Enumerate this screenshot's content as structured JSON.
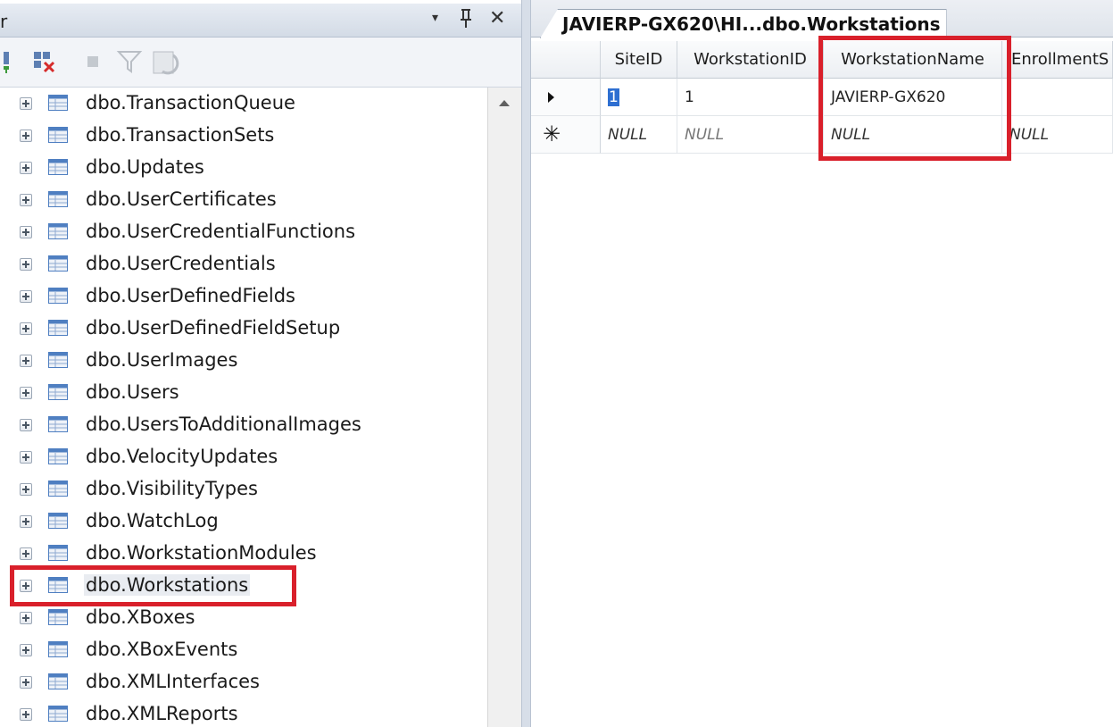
{
  "left_pane": {
    "title": "r",
    "dropdown_glyph": "▾",
    "pin_glyph": "ᚹ",
    "close_glyph": "✕",
    "toolbar": [
      "connect-icon",
      "disconnect-icon",
      "stop-icon",
      "filter-icon",
      "refresh-icon"
    ],
    "tree_items": [
      {
        "label": "dbo.TransactionQueue"
      },
      {
        "label": "dbo.TransactionSets"
      },
      {
        "label": "dbo.Updates"
      },
      {
        "label": "dbo.UserCertificates"
      },
      {
        "label": "dbo.UserCredentialFunctions"
      },
      {
        "label": "dbo.UserCredentials"
      },
      {
        "label": "dbo.UserDefinedFields"
      },
      {
        "label": "dbo.UserDefinedFieldSetup"
      },
      {
        "label": "dbo.UserImages"
      },
      {
        "label": "dbo.Users"
      },
      {
        "label": "dbo.UsersToAdditionalImages"
      },
      {
        "label": "dbo.VelocityUpdates"
      },
      {
        "label": "dbo.VisibilityTypes"
      },
      {
        "label": "dbo.WatchLog"
      },
      {
        "label": "dbo.WorkstationModules"
      },
      {
        "label": "dbo.Workstations",
        "selected": true
      },
      {
        "label": "dbo.XBoxes"
      },
      {
        "label": "dbo.XBoxEvents"
      },
      {
        "label": "dbo.XMLInterfaces"
      },
      {
        "label": "dbo.XMLReports"
      }
    ]
  },
  "right_pane": {
    "tab_label": "JAVIERP-GX620\\HI...dbo.Workstations",
    "columns": [
      "SiteID",
      "WorkstationID",
      "WorkstationName",
      "EnrollmentS"
    ],
    "rows": [
      {
        "indicator": "current",
        "SiteID": "1",
        "WorkstationID": "1",
        "WorkstationName": "JAVIERP-GX620",
        "EnrollmentS": ""
      },
      {
        "indicator": "new",
        "SiteID": "NULL",
        "WorkstationID": "NULL",
        "WorkstationName": "NULL",
        "EnrollmentS": "NULL"
      }
    ],
    "new_row_glyph": "✳"
  },
  "colors": {
    "highlight": "#d9202b",
    "selection": "#2e6fd1",
    "table_icon_header": "#4f7fc1"
  }
}
